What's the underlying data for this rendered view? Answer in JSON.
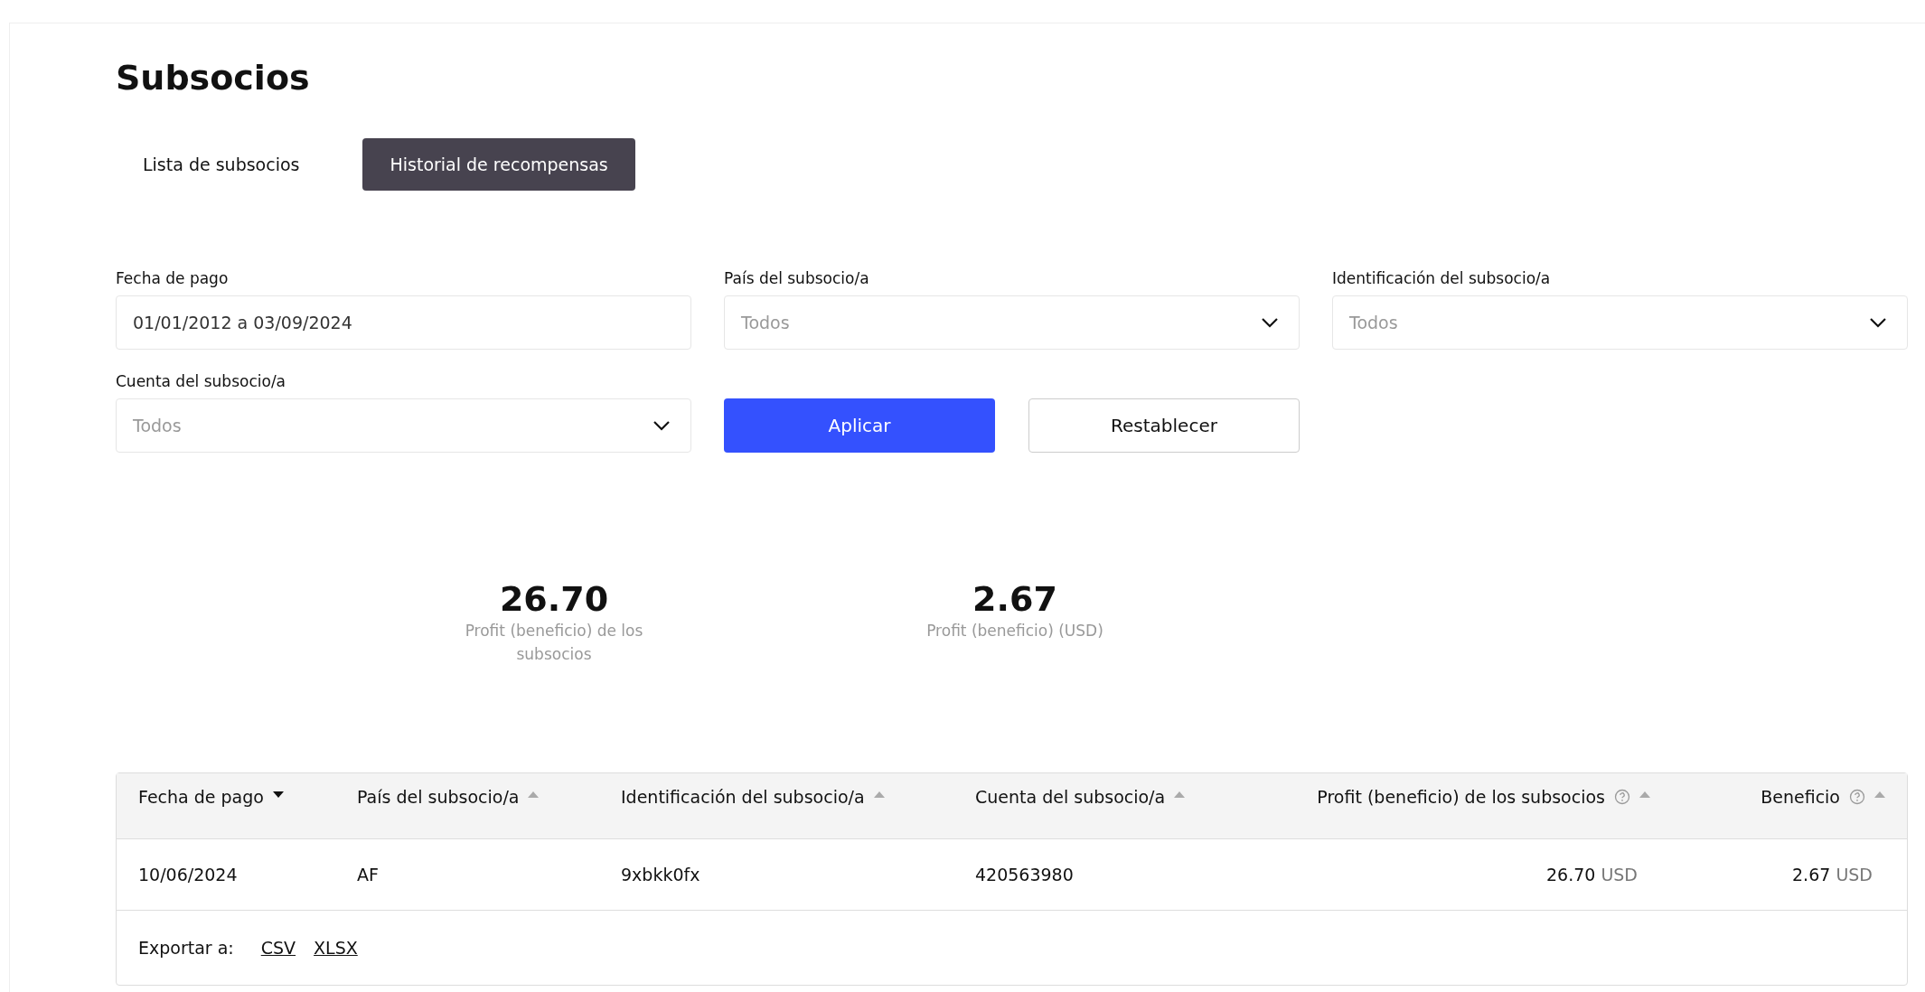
{
  "page": {
    "title": "Subsocios"
  },
  "tabs": [
    {
      "label": "Lista de subsocios",
      "selected": false
    },
    {
      "label": "Historial de recompensas",
      "selected": true
    }
  ],
  "filters": [
    {
      "kind": "text",
      "label": "Fecha de pago",
      "value": "01/01/2012 a 03/09/2024"
    },
    {
      "kind": "select",
      "label": "País del subsocio/a",
      "placeholder": "Todos"
    },
    {
      "kind": "select",
      "label": "Identificación del subsocio/a",
      "placeholder": "Todos"
    },
    {
      "kind": "select",
      "label": "Cuenta del subsocio/a",
      "placeholder": "Todos"
    }
  ],
  "buttons": [
    {
      "kind": "primary",
      "label": "Aplicar"
    },
    {
      "kind": "secondary",
      "label": "Restablecer"
    }
  ],
  "stats": [
    {
      "value": "26.70",
      "label": "Profit (beneficio) de los subsocios"
    },
    {
      "value": "2.67",
      "label": "Profit (beneficio) (USD)"
    }
  ],
  "table": {
    "columns": [
      {
        "label": "Fecha de pago",
        "numeric": false,
        "help": false,
        "sort_active": true
      },
      {
        "label": "País del subsocio/a",
        "numeric": false,
        "help": false,
        "sort_active": false
      },
      {
        "label": "Identificación del subsocio/a",
        "numeric": false,
        "help": false,
        "sort_active": false
      },
      {
        "label": "Cuenta del subsocio/a",
        "numeric": false,
        "help": false,
        "sort_active": false
      },
      {
        "label": "Profit (beneficio) de los subsocios",
        "numeric": true,
        "help": true,
        "sort_active": false
      },
      {
        "label": "Beneficio",
        "numeric": true,
        "help": true,
        "sort_active": false
      }
    ],
    "rows": [
      [
        {
          "value": "10/06/2024"
        },
        {
          "value": "AF"
        },
        {
          "value": "9xbkk0fx"
        },
        {
          "value": "420563980"
        },
        {
          "value": "26.70",
          "unit": "USD"
        },
        {
          "value": "2.67",
          "unit": "USD"
        }
      ]
    ]
  },
  "export": {
    "label": "Exportar a:",
    "links": [
      "CSV",
      "XLSX"
    ]
  }
}
